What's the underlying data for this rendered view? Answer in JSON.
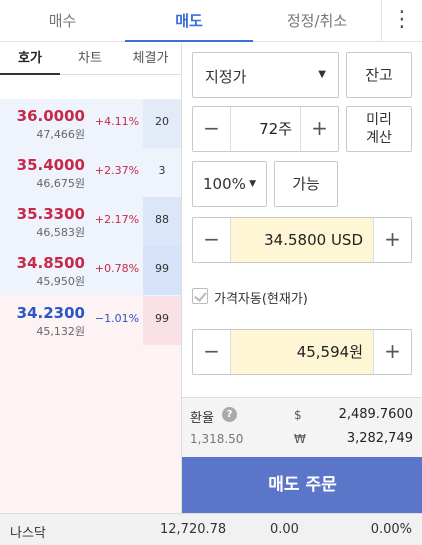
{
  "top_tabs": {
    "buy": "매수",
    "sell": "매도",
    "modify": "정정/취소",
    "more": "⋮"
  },
  "sub_tabs": {
    "quotes": "호가",
    "chart": "차트",
    "trades": "체결가"
  },
  "quotes": [
    {
      "price": "36.0000",
      "won": "47,466원",
      "pct": "+4.11%",
      "vol": "20",
      "dir": "up"
    },
    {
      "price": "35.4000",
      "won": "46,675원",
      "pct": "+2.37%",
      "vol": "3",
      "dir": "up"
    },
    {
      "price": "35.3300",
      "won": "46,583원",
      "pct": "+2.17%",
      "vol": "88",
      "dir": "up"
    },
    {
      "price": "34.8500",
      "won": "45,950원",
      "pct": "+0.78%",
      "vol": "99",
      "dir": "up"
    },
    {
      "price": "34.2300",
      "won": "45,132원",
      "pct": "−1.01%",
      "vol": "99",
      "dir": "down"
    }
  ],
  "order": {
    "order_type": "지정가",
    "balance_button": "잔고",
    "quantity": "72주",
    "preview_button_line1": "미리",
    "preview_button_line2": "계산",
    "percent": "100%",
    "available_button": "가능",
    "price_usd": "34.5800 USD",
    "auto_price_label": "가격자동(현재가)",
    "price_krw": "45,594원",
    "minus": "−",
    "plus": "+"
  },
  "fx": {
    "label": "환율",
    "help": "?",
    "rate": "1,318.50",
    "usd_symbol": "$",
    "usd_value": "2,489.7600",
    "krw_symbol": "₩",
    "krw_value": "3,282,749"
  },
  "sell_button": "매도 주문",
  "index_bar": {
    "name": "나스닥",
    "value": "12,720.78",
    "change": "0.00",
    "percent": "0.00%"
  },
  "colors": {
    "accent": "#3a6fd8",
    "up": "#c8294a",
    "down": "#2a56c6",
    "sell_button": "#5b76c9",
    "highlight": "#fff6d6"
  }
}
